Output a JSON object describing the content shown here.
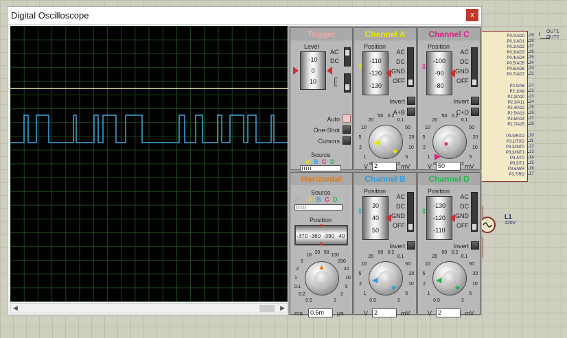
{
  "window": {
    "title": "Digital Oscilloscope",
    "close": "x"
  },
  "colors": {
    "chA": "#e6e600",
    "chB": "#2f9fe0",
    "chC": "#e0208a",
    "chD": "#1fb84a",
    "horizontal": "#e07a1a",
    "trigger": "#f0a8a8",
    "trace": "#3fa9e0",
    "hline": "#e8e6a6"
  },
  "trigger": {
    "title": "Trigger",
    "level_label": "Level",
    "level_ticks": [
      "-10",
      "0",
      "10"
    ],
    "ac": "AC",
    "dc": "DC",
    "auto": "Auto",
    "oneshot": "One-Shot",
    "cursors": "Cursors",
    "source_label": "Source",
    "sources": [
      "A",
      "B",
      "C",
      "D"
    ]
  },
  "channel_a": {
    "title": "Channel A",
    "position_label": "Position",
    "ticks": [
      "-110",
      "-120",
      "-130"
    ],
    "ac": "AC",
    "dc": "DC",
    "gnd": "GND",
    "off": "OFF",
    "invert": "Invert",
    "combine": "A+B",
    "knob_ticks": [
      "0.5",
      "1",
      "2",
      "5",
      "10",
      "20",
      "50",
      "0.2",
      "0.1",
      "50",
      "20",
      "10",
      "5",
      "2"
    ],
    "unit_left": "V",
    "value": "2",
    "unit_right": "mV"
  },
  "channel_c": {
    "title": "Channel C",
    "position_label": "Position",
    "ticks": [
      "-100",
      "-90",
      "-80"
    ],
    "ac": "AC",
    "dc": "DC",
    "gnd": "GND",
    "off": "OFF",
    "invert": "Invert",
    "combine": "C+D",
    "knob_ticks": [
      "0.5",
      "1",
      "2",
      "5",
      "10",
      "20",
      "50",
      "0.2",
      "0.1",
      "50",
      "20",
      "10",
      "5",
      "2"
    ],
    "unit_left": "V",
    "value": "50",
    "unit_right": "mV"
  },
  "horizontal": {
    "title": "Horizontal",
    "source_label": "Source",
    "sources": [
      "A",
      "B",
      "C",
      "D"
    ],
    "position_label": "Position",
    "position_ticks": [
      "-370",
      "-380",
      "-390",
      "-40"
    ],
    "knob_ticks": [
      "0.5",
      "0.2",
      "0.1",
      "1",
      "2",
      "5",
      "10",
      "20",
      "50",
      "100",
      "200",
      "20",
      "10",
      "5",
      "2",
      "1"
    ],
    "unit_left": "ms",
    "value": "0.5m",
    "unit_right": "µs"
  },
  "channel_b": {
    "title": "Channel B",
    "position_label": "Position",
    "ticks": [
      "30",
      "40",
      "50"
    ],
    "ac": "AC",
    "dc": "DC",
    "gnd": "GND",
    "off": "OFF",
    "invert": "Invert",
    "knob_ticks": [
      "0.5",
      "1",
      "2",
      "5",
      "10",
      "20",
      "50",
      "0.2",
      "0.1",
      "50",
      "20",
      "10",
      "5",
      "2"
    ],
    "unit_left": "V",
    "value": "2",
    "unit_right": "mV"
  },
  "channel_d": {
    "title": "Channel D",
    "position_label": "Position",
    "ticks": [
      "-130",
      "-120",
      "-110"
    ],
    "ac": "AC",
    "dc": "DC",
    "gnd": "GND",
    "off": "OFF",
    "invert": "Invert",
    "knob_ticks": [
      "0.5",
      "1",
      "2",
      "5",
      "10",
      "20",
      "50",
      "0.2",
      "0.1",
      "50",
      "20",
      "10",
      "5",
      "2"
    ],
    "unit_left": "V",
    "value": "2",
    "unit_right": "mV"
  },
  "chip": {
    "pins_p0": [
      "P0.0/AD0",
      "P0.1/AD1",
      "P0.2/AD2",
      "P0.3/AD3",
      "P0.4/AD4",
      "P0.5/AD5",
      "P0.6/AD6",
      "P0.7/AD7"
    ],
    "nums_p0": [
      "39",
      "38",
      "37",
      "36",
      "35",
      "34",
      "33",
      "32"
    ],
    "pins_p2": [
      "P2.0/A8",
      "P2.1/A9",
      "P2.2/A10",
      "P2.3/A11",
      "P2.4/A12",
      "P2.5/A13",
      "P2.6/A14",
      "P2.7/A15"
    ],
    "nums_p2": [
      "21",
      "22",
      "23",
      "24",
      "25",
      "26",
      "27",
      "28"
    ],
    "pins_p3": [
      "P3.0/RXD",
      "P3.1/TXD",
      "P3.2/INT0",
      "P3.3/INT1",
      "P3.4/T0",
      "P3.5/T1",
      "P3.6/WR",
      "P3.7/RD"
    ],
    "nums_p3": [
      "10",
      "11",
      "12",
      "13",
      "14",
      "15",
      "16",
      "17"
    ],
    "out1": "OUT1",
    "out2": "OUT2"
  },
  "lamp": {
    "name": "L1",
    "voltage": "220V"
  }
}
